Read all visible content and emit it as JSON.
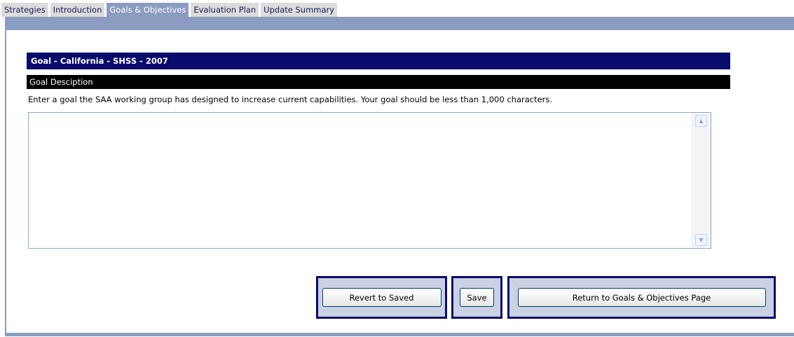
{
  "tabs": [
    {
      "label": "Strategies",
      "active": false
    },
    {
      "label": "Introduction",
      "active": false
    },
    {
      "label": "Goals & Objectives",
      "active": true
    },
    {
      "label": "Evaluation Plan",
      "active": false
    },
    {
      "label": "Update Summary",
      "active": false
    }
  ],
  "goal": {
    "header": "Goal - California - SHSS - 2007",
    "description_label": "Goal Desciption",
    "instructions": "Enter a goal the SAA working group has designed to increase current capabilities. Your goal should be less than 1,000 characters.",
    "value": ""
  },
  "buttons": {
    "revert": "Revert to Saved",
    "save": "Save",
    "return": "Return to Goals & Objectives Page"
  },
  "colors": {
    "header_navy": "#0b0b6b",
    "tab_active": "#8c9cc0",
    "tab_inactive": "#dcdcdc"
  },
  "icons": {
    "scroll_up": "scroll-up-arrow-icon",
    "scroll_down": "scroll-down-arrow-icon"
  }
}
